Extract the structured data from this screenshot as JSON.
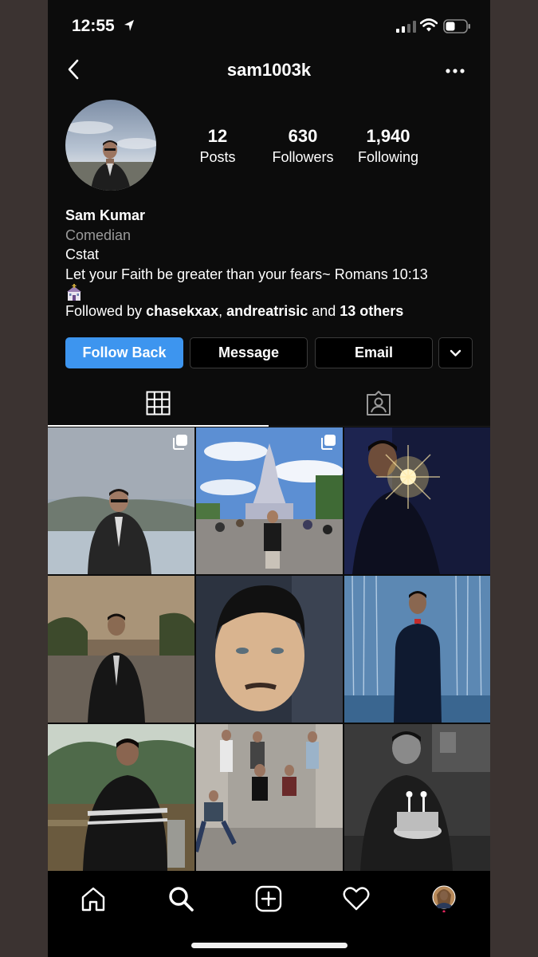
{
  "status": {
    "time": "12:55"
  },
  "header": {
    "username": "sam1003k"
  },
  "stats": [
    {
      "num": "12",
      "label": "Posts"
    },
    {
      "num": "630",
      "label": "Followers"
    },
    {
      "num": "1,940",
      "label": "Following"
    }
  ],
  "bio": {
    "name": "Sam Kumar",
    "category": "Comedian",
    "line1": "Cstat",
    "line2": "Let your Faith be greater than your fears~ Romans 10:13",
    "followed_prefix": "Followed by ",
    "follower1": "chasekxax",
    "sep": ", ",
    "follower2": "andreatrisic",
    "and": " and ",
    "others": "13 others"
  },
  "buttons": {
    "follow_back": "Follow Back",
    "message": "Message",
    "email": "Email"
  },
  "colors": {
    "accent": "#3d95ef",
    "background": "#0c0c0c"
  }
}
